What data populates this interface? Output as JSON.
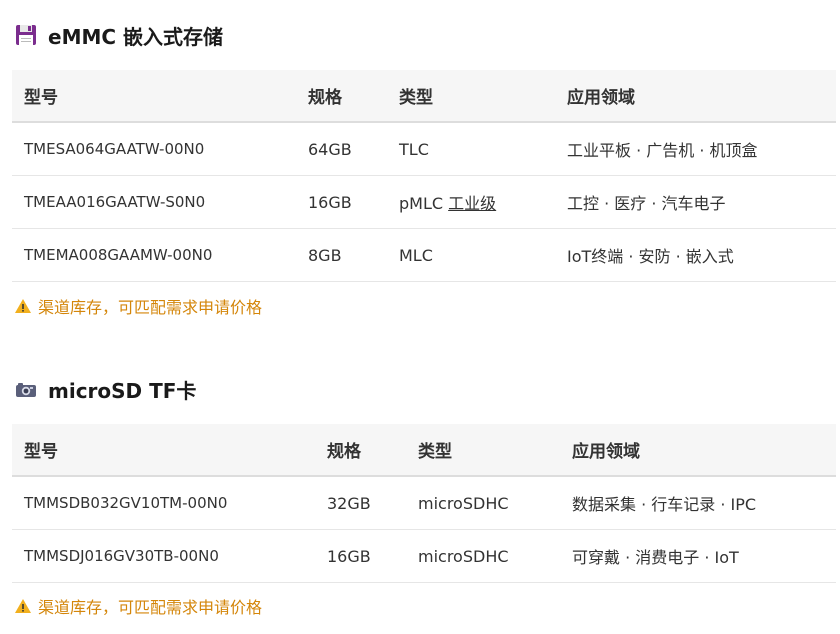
{
  "sections": [
    {
      "title": "eMMC 嵌入式存储",
      "icon": "floppy-disk-icon",
      "headers": [
        "型号",
        "规格",
        "类型",
        "应用领域"
      ],
      "rows": [
        {
          "model": "TMESA064GAATW-00N0",
          "capacity": "64GB",
          "type": "TLC",
          "grade": "",
          "apps": "工业平板 · 广告机 · 机顶盒"
        },
        {
          "model": "TMEAA016GAATW-S0N0",
          "capacity": "16GB",
          "type": "pMLC ",
          "grade": "工业级",
          "apps": "工控 · 医疗 · 汽车电子"
        },
        {
          "model": "TMEMA008GAAMW-00N0",
          "capacity": "8GB",
          "type": "MLC",
          "grade": "",
          "apps": "IoT终端 · 安防 · 嵌入式"
        }
      ],
      "notice": "渠道库存，可匹配需求申请价格"
    },
    {
      "title": "microSD TF卡",
      "icon": "camera-icon",
      "headers": [
        "型号",
        "规格",
        "类型",
        "应用领域"
      ],
      "rows": [
        {
          "model": "TMMSDB032GV10TM-00N0",
          "capacity": "32GB",
          "type": "microSDHC",
          "grade": "",
          "apps": "数据采集 · 行车记录 · IPC"
        },
        {
          "model": "TMMSDJ016GV30TB-00N0",
          "capacity": "16GB",
          "type": "microSDHC",
          "grade": "",
          "apps": "可穿戴 · 消费电子 · IoT"
        }
      ],
      "notice": "渠道库存，可匹配需求申请价格"
    }
  ],
  "colors": {
    "notice": "#d4860a",
    "header_bg": "#f6f6f6",
    "floppy": "#7b2d8e"
  }
}
